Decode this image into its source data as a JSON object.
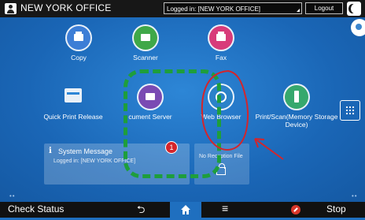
{
  "topbar": {
    "office_name": "NEW YORK OFFICE",
    "login_status": "Logged in: [NEW YORK OFFICE]",
    "logout_label": "Logout",
    "user_icon": "user-icon",
    "night_icon": "moon-icon"
  },
  "apps": [
    {
      "label": "Copy",
      "icon": "copy-icon",
      "color": "#3d7ed6"
    },
    {
      "label": "Scanner",
      "icon": "scanner-icon",
      "color": "#3fa848"
    },
    {
      "label": "Fax",
      "icon": "fax-icon",
      "color": "#d83b7a"
    },
    {
      "label": "Quick Print Release",
      "icon": "print-release-icon"
    },
    {
      "label": "cument Server",
      "icon": "document-server-icon",
      "color": "#7a4bb3"
    },
    {
      "label": "Web Browser",
      "icon": "globe-icon",
      "color": "#2b82c9"
    },
    {
      "label": "Print/Scan(Memory Storage Device)",
      "icon": "usb-icon",
      "color": "#36a86d"
    }
  ],
  "system_message": {
    "title": "System Message",
    "body": "Logged in: [NEW YORK OFFICE]"
  },
  "received_file": {
    "text": "No Reception File"
  },
  "annotation": {
    "badge": "1",
    "dashed_color": "#1e9e3c",
    "circle_color": "#d4252b"
  },
  "bottombar": {
    "check_status": "Check Status",
    "stop_label": "Stop",
    "back_glyph": "⮌",
    "menu_glyph": "≡"
  },
  "colors": {
    "background": "#1f6fbf",
    "bar": "#111111"
  }
}
